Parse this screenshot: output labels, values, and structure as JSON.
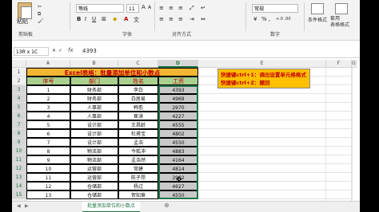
{
  "ribbon": {
    "paste_label": "粘贴",
    "clipboard_group": "剪贴板",
    "font_group": "字体",
    "align_group": "对齐方式",
    "number_group": "数字",
    "font_name": "等线",
    "font_size": "11",
    "number_format": "常规",
    "bold": "B",
    "italic": "I",
    "underline": "U",
    "wen": "文",
    "cond_format": "条件格式",
    "table_format": "套用\n表格格式",
    "percent": "% ,",
    "inc_dec": "+.0 .00"
  },
  "formula_bar": {
    "name_box": "13R x 1C",
    "fx": "fx",
    "value": "4393"
  },
  "columns": [
    "A",
    "B",
    "C",
    "D",
    "E",
    "F",
    "G"
  ],
  "rows": [
    "1",
    "2",
    "3",
    "4",
    "5",
    "6",
    "7",
    "8",
    "9",
    "10",
    "11",
    "12",
    "13",
    "14",
    "15",
    "16",
    "17"
  ],
  "sheet": {
    "title": "Excel表格：批量添加单位和小数点",
    "headers": [
      "序号",
      "部门",
      "姓名",
      "工资"
    ],
    "data": [
      [
        "1",
        "财务部",
        "李白",
        "4393"
      ],
      [
        "2",
        "财务部",
        "白居易",
        "4969"
      ],
      [
        "3",
        "人事部",
        "韩愈",
        "2970"
      ],
      [
        "4",
        "人事部",
        "崔涛",
        "4227"
      ],
      [
        "5",
        "设计部",
        "王昌龄",
        "4555"
      ],
      [
        "6",
        "设计部",
        "杜甫宝",
        "4802"
      ],
      [
        "7",
        "设计部",
        "孟浩",
        "4550"
      ],
      [
        "8",
        "物流部",
        "今狐冲",
        "4883"
      ],
      [
        "9",
        "物流部",
        "孟浩然",
        "4164"
      ],
      [
        "10",
        "运营部",
        "常建",
        "4814"
      ],
      [
        "11",
        "运营部",
        "陈子昂",
        "2902"
      ],
      [
        "12",
        "仓储部",
        "杨过",
        "4627"
      ],
      [
        "13",
        "仓储部",
        "贺知章",
        "4550"
      ]
    ]
  },
  "notes": [
    "快捷键ctrl+1：调出设置单元格格式",
    "快捷键ctrl+Z：撤回"
  ],
  "tabs": {
    "active": "批量添加单位和小数点"
  }
}
